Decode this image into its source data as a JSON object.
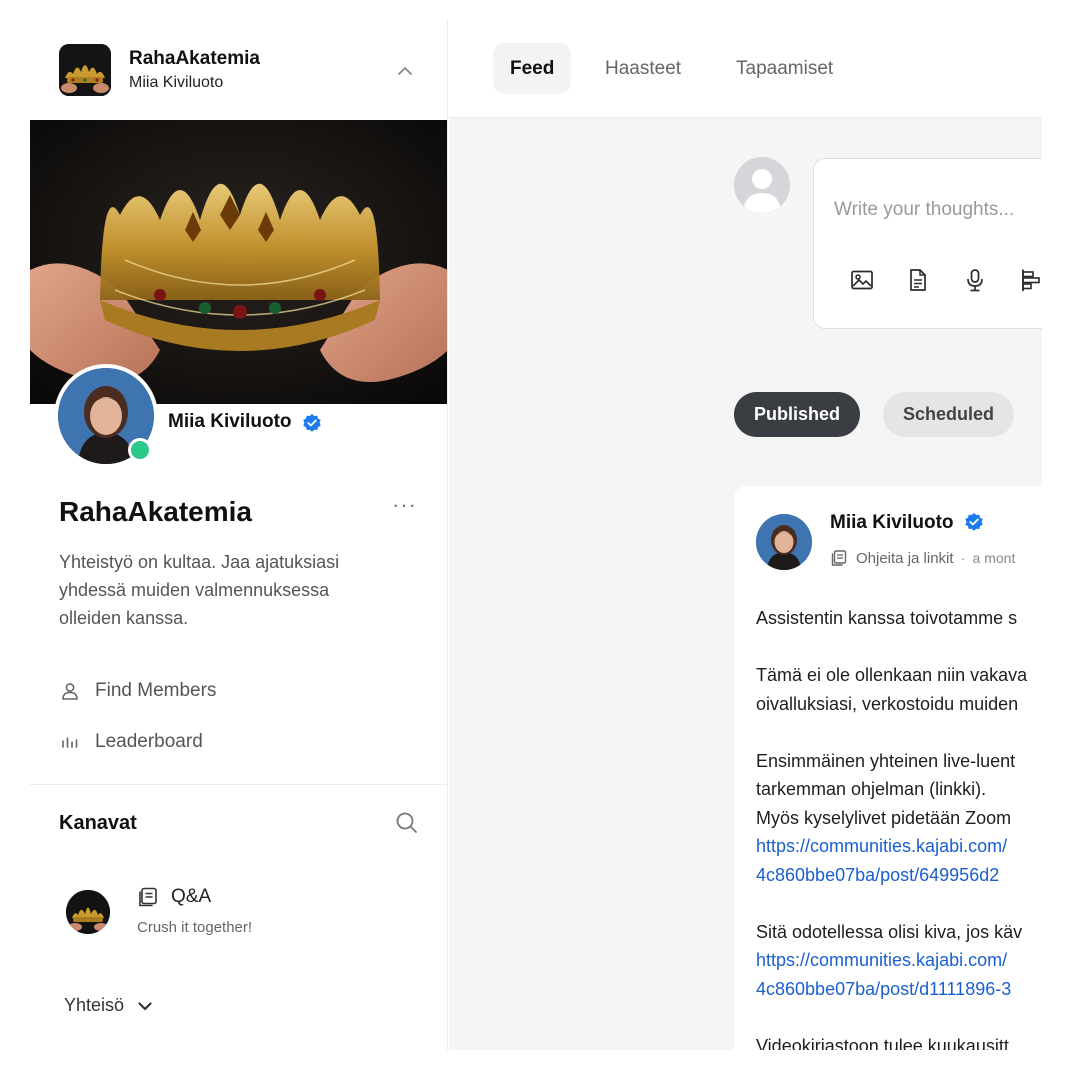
{
  "sidebar": {
    "community_title": "RahaAkatemia",
    "owner_name": "Miia Kiviluoto",
    "profile": {
      "name": "Miia Kiviluoto",
      "verified": true,
      "online": true
    },
    "community": {
      "name": "RahaAkatemia",
      "description": "Yhteistyö on kultaa. Jaa ajatuksiasi yhdessä muiden valmennuksessa olleiden kanssa."
    },
    "nav": [
      {
        "label": "Find Members",
        "icon": "person-icon"
      },
      {
        "label": "Leaderboard",
        "icon": "bar-chart-icon"
      }
    ],
    "channels": {
      "title": "Kanavat",
      "items": [
        {
          "name": "Q&A",
          "subtitle": "Crush it together!",
          "icon": "document-icon"
        }
      ]
    },
    "community_toggle": "Yhteisö"
  },
  "topnav": {
    "tabs": [
      {
        "label": "Feed",
        "active": true
      },
      {
        "label": "Haasteet",
        "active": false
      },
      {
        "label": "Tapaamiset",
        "active": false
      }
    ]
  },
  "composer": {
    "placeholder": "Write your thoughts...",
    "tools": [
      "image-icon",
      "document-icon",
      "microphone-icon",
      "poll-icon"
    ]
  },
  "filters": {
    "published": "Published",
    "scheduled": "Scheduled"
  },
  "post": {
    "author": "Miia Kiviluoto",
    "verified": true,
    "channel": "Ohjeita ja linkit",
    "time": "a mont",
    "lines": {
      "l1": "Assistentin kanssa toivotamme s",
      "l2": "Tämä ei ole ollenkaan niin vakava",
      "l3": "oivalluksiasi, verkostoidu muiden",
      "l4": "Ensimmäinen yhteinen live-luent",
      "l5": "tarkemman ohjelman (linkki).",
      "l6": "Myös kyselylivet pidetään Zoom",
      "l7": "https://communities.kajabi.com/",
      "l8": "4c860bbe07ba/post/649956d2",
      "l9": "Sitä odotellessa olisi kiva, jos käv",
      "l10": "https://communities.kajabi.com/",
      "l11": "4c860bbe07ba/post/d1111896-3",
      "l12": "Videokirjastoon tulee kuukausitt"
    }
  },
  "colors": {
    "accent_green": "#2dc98a",
    "verified_blue": "#1d7bf0",
    "link_blue": "#1a5fd0",
    "pill_dark": "#3a3d42"
  }
}
